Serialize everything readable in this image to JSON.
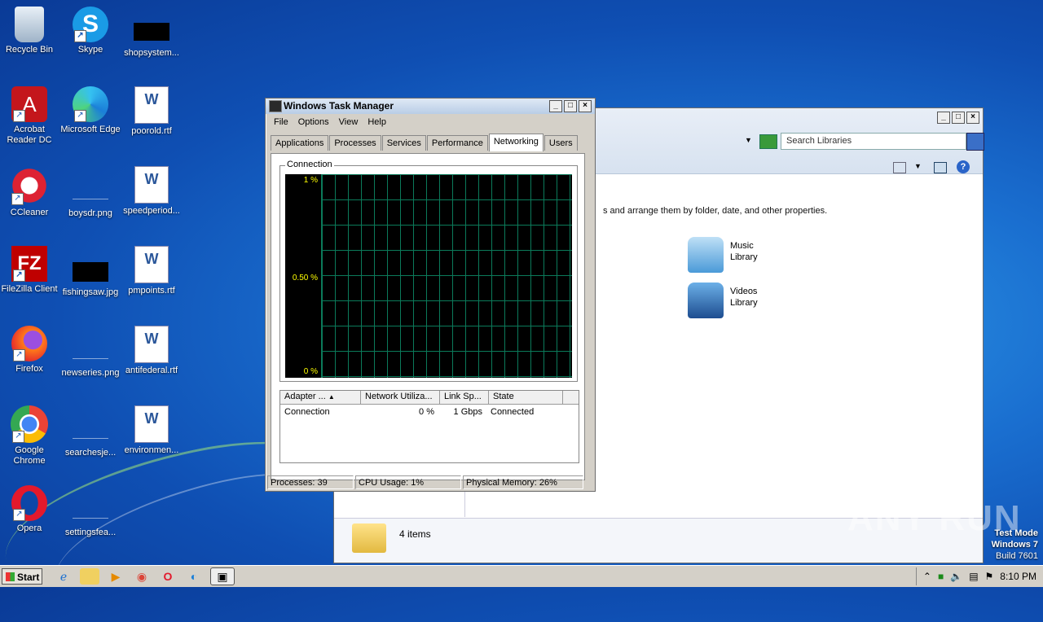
{
  "desktop": {
    "icons": [
      {
        "label": "Recycle Bin"
      },
      {
        "label": "Skype"
      },
      {
        "label": "shopsystem..."
      },
      {
        "label": "Acrobat Reader DC"
      },
      {
        "label": "Microsoft Edge"
      },
      {
        "label": "poorold.rtf"
      },
      {
        "label": "CCleaner"
      },
      {
        "label": "boysdr.png"
      },
      {
        "label": "speedperiod..."
      },
      {
        "label": "FileZilla Client"
      },
      {
        "label": "fishingsaw.jpg"
      },
      {
        "label": "pmpoints.rtf"
      },
      {
        "label": "Firefox"
      },
      {
        "label": "newseries.png"
      },
      {
        "label": "antifederal.rtf"
      },
      {
        "label": "Google Chrome"
      },
      {
        "label": "searchesje..."
      },
      {
        "label": "environmen..."
      },
      {
        "label": "Opera"
      },
      {
        "label": "settingsfea..."
      }
    ]
  },
  "taskmgr": {
    "title": "Windows Task Manager",
    "menu": [
      "File",
      "Options",
      "View",
      "Help"
    ],
    "tabs": [
      "Applications",
      "Processes",
      "Services",
      "Performance",
      "Networking",
      "Users"
    ],
    "active_tab": "Networking",
    "graph": {
      "label": "Connection",
      "y_top": "1 %",
      "y_mid": "0.50 %",
      "y_bot": "0 %"
    },
    "columns": [
      "Adapter ...",
      "Network Utiliza...",
      "Link Sp...",
      "State"
    ],
    "rows": [
      {
        "adapter": "Connection",
        "util": "0 %",
        "speed": "1 Gbps",
        "state": "Connected"
      }
    ],
    "status": {
      "processes": "Processes: 39",
      "cpu": "CPU Usage: 1%",
      "memory": "Physical Memory: 26%"
    }
  },
  "explorer": {
    "search_placeholder": "Search Libraries",
    "message": "s and arrange them by folder, date, and other properties.",
    "libraries": [
      {
        "line1": "Music",
        "line2": "Library"
      },
      {
        "line1": "Videos",
        "line2": "Library"
      }
    ],
    "footer": "4 items"
  },
  "watermark": "ANY RUN",
  "testmode": {
    "line1": "Test Mode",
    "line2": "Windows 7",
    "line3": "Build 7601"
  },
  "taskbar": {
    "start": "Start",
    "clock": "8:10 PM"
  }
}
